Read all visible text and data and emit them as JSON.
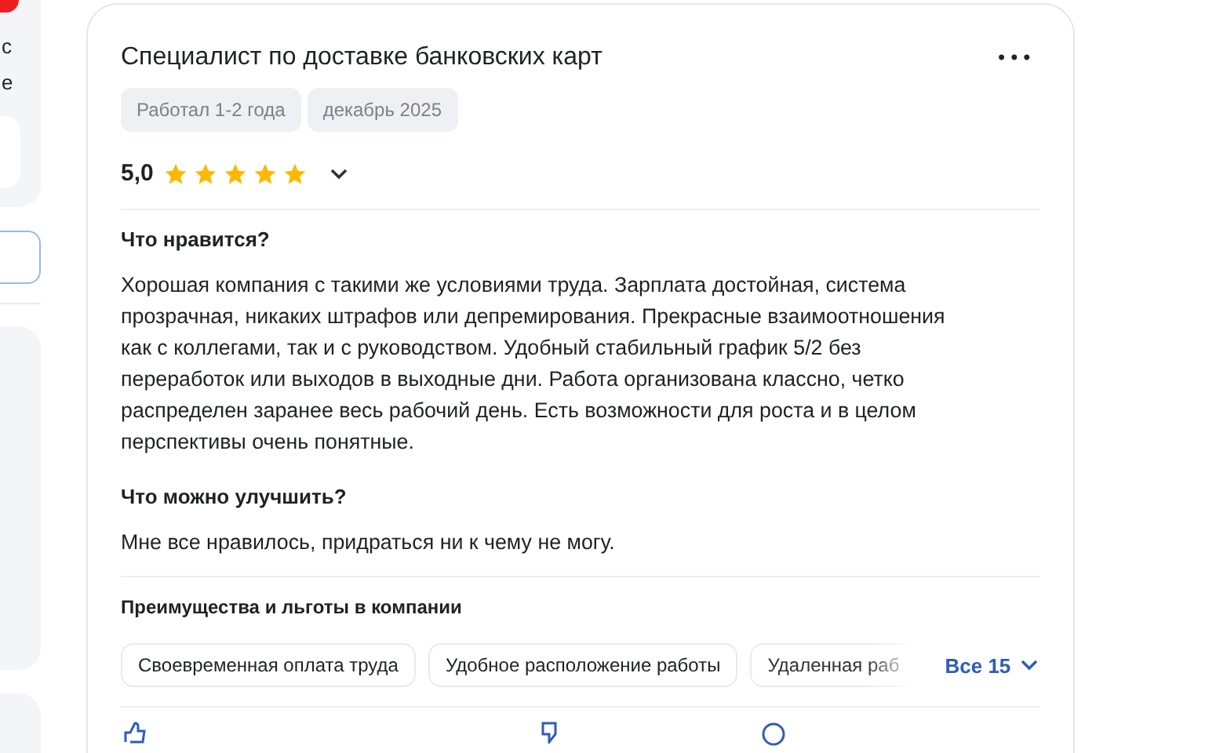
{
  "side_fragments": [
    "с",
    "е"
  ],
  "review": {
    "title": "Специалист по доставке банковских карт",
    "menu": "•••",
    "tags": [
      "Работал 1-2 года",
      "декабрь 2025"
    ],
    "rating": "5,0",
    "stars": 5,
    "sections": [
      {
        "heading": "Что нравится?",
        "text": "Хорошая компания с такими же условиями труда. Зарплата достойная, система прозрачная, никаких штрафов или депремирования. Прекрасные взаимоотношения как с коллегами, так и с руководством. Удобный стабильный график 5/2 без переработок или выходов в выходные дни. Работа организована классно, четко распределен заранее весь рабочий день. Есть возможности для роста и в целом перспективы очень понятные."
      },
      {
        "heading": "Что можно улучшить?",
        "text": "Мне все нравилось, придраться ни к чему не могу."
      }
    ],
    "benefits_title": "Преимущества и льготы в компании",
    "benefits": [
      "Своевременная оплата труда",
      "Удобное расположение работы",
      "Удаленная раб"
    ],
    "benefits_more": "Все 15"
  }
}
